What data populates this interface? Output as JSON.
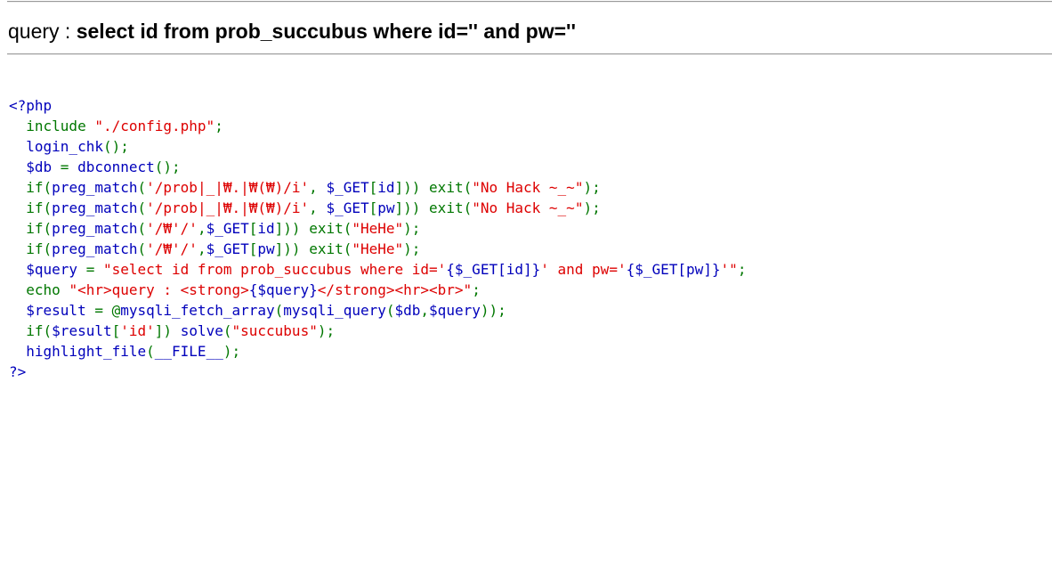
{
  "query_display": {
    "label": "query : ",
    "sql": "select id from prob_succubus where id='' and pw=''"
  },
  "source": {
    "language": "php",
    "colors": {
      "default": "#0000BB",
      "keyword": "#007700",
      "string": "#DD0000"
    },
    "lines": [
      [
        {
          "t": "<?php",
          "c": "default"
        }
      ],
      [
        {
          "t": "  ",
          "c": "default"
        },
        {
          "t": "include ",
          "c": "keyword"
        },
        {
          "t": "\"./config.php\"",
          "c": "string"
        },
        {
          "t": ";",
          "c": "keyword"
        }
      ],
      [
        {
          "t": "  login_chk",
          "c": "default"
        },
        {
          "t": "();",
          "c": "keyword"
        }
      ],
      [
        {
          "t": "  $db ",
          "c": "default"
        },
        {
          "t": "= ",
          "c": "keyword"
        },
        {
          "t": "dbconnect",
          "c": "default"
        },
        {
          "t": "();",
          "c": "keyword"
        }
      ],
      [
        {
          "t": "  ",
          "c": "default"
        },
        {
          "t": "if(",
          "c": "keyword"
        },
        {
          "t": "preg_match",
          "c": "default"
        },
        {
          "t": "(",
          "c": "keyword"
        },
        {
          "t": "'/prob|_|₩.|₩(₩)/i'",
          "c": "string"
        },
        {
          "t": ", ",
          "c": "keyword"
        },
        {
          "t": "$_GET",
          "c": "default"
        },
        {
          "t": "[",
          "c": "keyword"
        },
        {
          "t": "id",
          "c": "default"
        },
        {
          "t": "])) exit(",
          "c": "keyword"
        },
        {
          "t": "\"No Hack ~_~\"",
          "c": "string"
        },
        {
          "t": ");",
          "c": "keyword"
        }
      ],
      [
        {
          "t": "  ",
          "c": "default"
        },
        {
          "t": "if(",
          "c": "keyword"
        },
        {
          "t": "preg_match",
          "c": "default"
        },
        {
          "t": "(",
          "c": "keyword"
        },
        {
          "t": "'/prob|_|₩.|₩(₩)/i'",
          "c": "string"
        },
        {
          "t": ", ",
          "c": "keyword"
        },
        {
          "t": "$_GET",
          "c": "default"
        },
        {
          "t": "[",
          "c": "keyword"
        },
        {
          "t": "pw",
          "c": "default"
        },
        {
          "t": "])) exit(",
          "c": "keyword"
        },
        {
          "t": "\"No Hack ~_~\"",
          "c": "string"
        },
        {
          "t": ");",
          "c": "keyword"
        }
      ],
      [
        {
          "t": "  ",
          "c": "default"
        },
        {
          "t": "if(",
          "c": "keyword"
        },
        {
          "t": "preg_match",
          "c": "default"
        },
        {
          "t": "(",
          "c": "keyword"
        },
        {
          "t": "'/₩'/'",
          "c": "string"
        },
        {
          "t": ",",
          "c": "keyword"
        },
        {
          "t": "$_GET",
          "c": "default"
        },
        {
          "t": "[",
          "c": "keyword"
        },
        {
          "t": "id",
          "c": "default"
        },
        {
          "t": "])) exit(",
          "c": "keyword"
        },
        {
          "t": "\"HeHe\"",
          "c": "string"
        },
        {
          "t": ");",
          "c": "keyword"
        }
      ],
      [
        {
          "t": "  ",
          "c": "default"
        },
        {
          "t": "if(",
          "c": "keyword"
        },
        {
          "t": "preg_match",
          "c": "default"
        },
        {
          "t": "(",
          "c": "keyword"
        },
        {
          "t": "'/₩'/'",
          "c": "string"
        },
        {
          "t": ",",
          "c": "keyword"
        },
        {
          "t": "$_GET",
          "c": "default"
        },
        {
          "t": "[",
          "c": "keyword"
        },
        {
          "t": "pw",
          "c": "default"
        },
        {
          "t": "])) exit(",
          "c": "keyword"
        },
        {
          "t": "\"HeHe\"",
          "c": "string"
        },
        {
          "t": ");",
          "c": "keyword"
        }
      ],
      [
        {
          "t": "  $query ",
          "c": "default"
        },
        {
          "t": "= ",
          "c": "keyword"
        },
        {
          "t": "\"select id from prob_succubus where id='",
          "c": "string"
        },
        {
          "t": "{$_GET[id]}",
          "c": "default"
        },
        {
          "t": "' and pw='",
          "c": "string"
        },
        {
          "t": "{$_GET[pw]}",
          "c": "default"
        },
        {
          "t": "'\"",
          "c": "string"
        },
        {
          "t": ";",
          "c": "keyword"
        }
      ],
      [
        {
          "t": "  ",
          "c": "default"
        },
        {
          "t": "echo ",
          "c": "keyword"
        },
        {
          "t": "\"<hr>query : <strong>",
          "c": "string"
        },
        {
          "t": "{$query}",
          "c": "default"
        },
        {
          "t": "</strong><hr><br>\"",
          "c": "string"
        },
        {
          "t": ";",
          "c": "keyword"
        }
      ],
      [
        {
          "t": "  $result ",
          "c": "default"
        },
        {
          "t": "= @",
          "c": "keyword"
        },
        {
          "t": "mysqli_fetch_array",
          "c": "default"
        },
        {
          "t": "(",
          "c": "keyword"
        },
        {
          "t": "mysqli_query",
          "c": "default"
        },
        {
          "t": "(",
          "c": "keyword"
        },
        {
          "t": "$db",
          "c": "default"
        },
        {
          "t": ",",
          "c": "keyword"
        },
        {
          "t": "$query",
          "c": "default"
        },
        {
          "t": "));",
          "c": "keyword"
        }
      ],
      [
        {
          "t": "  ",
          "c": "default"
        },
        {
          "t": "if(",
          "c": "keyword"
        },
        {
          "t": "$result",
          "c": "default"
        },
        {
          "t": "[",
          "c": "keyword"
        },
        {
          "t": "'id'",
          "c": "string"
        },
        {
          "t": "]) ",
          "c": "keyword"
        },
        {
          "t": "solve",
          "c": "default"
        },
        {
          "t": "(",
          "c": "keyword"
        },
        {
          "t": "\"succubus\"",
          "c": "string"
        },
        {
          "t": ");",
          "c": "keyword"
        }
      ],
      [
        {
          "t": "  highlight_file",
          "c": "default"
        },
        {
          "t": "(",
          "c": "keyword"
        },
        {
          "t": "__FILE__",
          "c": "default"
        },
        {
          "t": ");",
          "c": "keyword"
        }
      ],
      [
        {
          "t": "?>",
          "c": "default"
        }
      ]
    ]
  }
}
